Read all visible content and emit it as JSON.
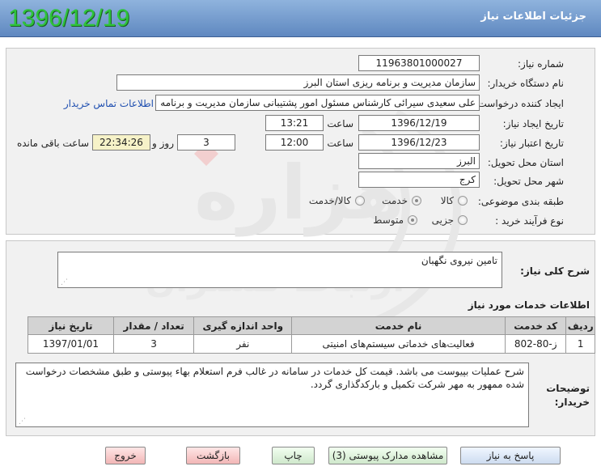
{
  "header": {
    "title": "جزئیات اطلاعات نیاز",
    "date_stamp": "1396/12/19"
  },
  "form": {
    "need_number_label": "شماره نیاز:",
    "need_number": "1196380100002‏7",
    "buyer_label": "نام دستگاه خریدار:",
    "buyer": "سازمان مدیریت و برنامه ریزی استان البرز",
    "requester_label": "ایجاد کننده درخواست:",
    "requester": "علی سعیدی سیرائی کارشناس مسئول امور پشتیبانی سازمان مدیریت و برنامه",
    "contact_link": "اطلاعات تماس خریدار",
    "created_label": "تاریخ ایجاد نیاز:",
    "created_date": "1396/12/19",
    "time_label": "ساعت",
    "created_time": "13:21",
    "validity_label": "تاریخ اعتبار نیاز:",
    "validity_date": "1396/12/23",
    "validity_time": "12:00",
    "days_value": "3",
    "days_label": "روز و",
    "remaining_time": "22:34:26",
    "remaining_label": "ساعت باقی مانده",
    "province_label": "استان محل تحویل:",
    "province": "البرز",
    "city_label": "شهر محل تحویل:",
    "city": "کرج",
    "category_label": "طبقه بندی موضوعی:",
    "category_options": [
      "کالا",
      "خدمت",
      "کالا/خدمت"
    ],
    "category_selected": "خدمت",
    "process_label": "نوع فرآیند خرید :",
    "process_options": [
      "جزیی",
      "متوسط"
    ],
    "process_selected": "متوسط"
  },
  "watermark": {
    "text_main": "هزاره",
    "text_sub": "ارتباط گستران"
  },
  "description": {
    "label": "شرح کلی نیاز:",
    "value": "تامین نیروی نگهبان"
  },
  "services": {
    "title": "اطلاعات خدمات مورد نیاز",
    "columns": [
      "ردیف",
      "کد خدمت",
      "نام خدمت",
      "واحد اندازه گیری",
      "تعداد / مقدار",
      "تاریخ نیاز"
    ],
    "rows": [
      [
        "1",
        "ز-80-802",
        "فعالیت‌های خدماتی سیستم‌های امنیتی",
        "نفر",
        "3",
        "1397/01/01"
      ]
    ]
  },
  "buyer_notes": {
    "label_line1": "توضیحات",
    "label_line2": "خریدار:",
    "value": "شرح عملیات بپیوست می باشد. قیمت کل خدمات در سامانه در غالب فرم استعلام بهاء پیوستی  و طبق مشخصات درخواست شده ممهور به مهر شرکت تکمیل و بارکدگذاری گردد."
  },
  "buttons": {
    "reply": "پاسخ به نیاز",
    "attachments": "مشاهده مدارک پیوستی (3)",
    "print": "چاپ",
    "back": "بازگشت",
    "exit": "خروج"
  }
}
